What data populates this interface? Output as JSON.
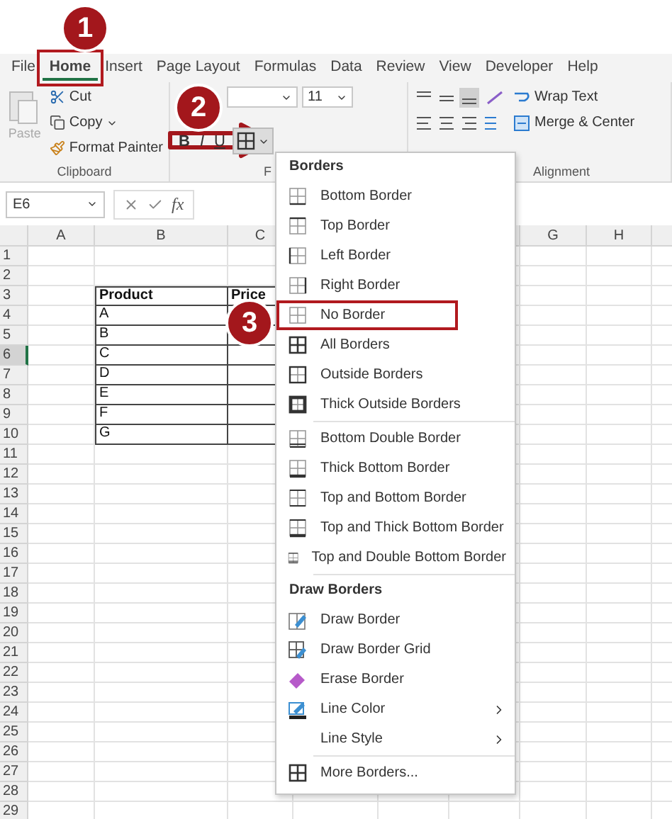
{
  "tabs": [
    {
      "label": "File",
      "selected": false,
      "highlighted": false
    },
    {
      "label": "Home",
      "selected": true,
      "highlighted": true
    },
    {
      "label": "Insert",
      "selected": false,
      "highlighted": false
    },
    {
      "label": "Page Layout",
      "selected": false,
      "highlighted": false
    },
    {
      "label": "Formulas",
      "selected": false,
      "highlighted": false
    },
    {
      "label": "Data",
      "selected": false,
      "highlighted": false
    },
    {
      "label": "Review",
      "selected": false,
      "highlighted": false
    },
    {
      "label": "View",
      "selected": false,
      "highlighted": false
    },
    {
      "label": "Developer",
      "selected": false,
      "highlighted": false
    },
    {
      "label": "Help",
      "selected": false,
      "highlighted": false
    }
  ],
  "clipboard": {
    "paste": "Paste",
    "paste_disabled": true,
    "cut": "Cut",
    "copy": "Copy",
    "format_painter": "Format Painter",
    "label": "Clipboard"
  },
  "font": {
    "size": "11",
    "bold": "B",
    "italic": "I",
    "underline": "U",
    "label": "F"
  },
  "alignment": {
    "wrap_text": "Wrap Text",
    "merge_center": "Merge & Center",
    "label": "Alignment"
  },
  "formula_bar": {
    "name_box": "E6",
    "function": "fx"
  },
  "columns": [
    "A",
    "B",
    "C",
    "G",
    "H"
  ],
  "rows": [
    {
      "number": "1",
      "selected": false
    },
    {
      "number": "2",
      "selected": false
    },
    {
      "number": "3",
      "selected": false
    },
    {
      "number": "4",
      "selected": false
    },
    {
      "number": "5",
      "selected": false
    },
    {
      "number": "6",
      "selected": true
    },
    {
      "number": "7",
      "selected": false
    },
    {
      "number": "8",
      "selected": false
    },
    {
      "number": "9",
      "selected": false
    },
    {
      "number": "10",
      "selected": false
    },
    {
      "number": "11",
      "selected": false
    },
    {
      "number": "12",
      "selected": false
    },
    {
      "number": "13",
      "selected": false
    },
    {
      "number": "14",
      "selected": false
    },
    {
      "number": "15",
      "selected": false
    },
    {
      "number": "16",
      "selected": false
    },
    {
      "number": "17",
      "selected": false
    },
    {
      "number": "18",
      "selected": false
    },
    {
      "number": "19",
      "selected": false
    },
    {
      "number": "20",
      "selected": false
    },
    {
      "number": "21",
      "selected": false
    },
    {
      "number": "22",
      "selected": false
    },
    {
      "number": "23",
      "selected": false
    },
    {
      "number": "24",
      "selected": false
    },
    {
      "number": "25",
      "selected": false
    },
    {
      "number": "26",
      "selected": false
    },
    {
      "number": "27",
      "selected": false
    },
    {
      "number": "28",
      "selected": false
    },
    {
      "number": "29",
      "selected": false
    }
  ],
  "table": {
    "header": [
      "Product",
      "Price"
    ],
    "rows": [
      "A",
      "B",
      "C",
      "D",
      "E",
      "F",
      "G"
    ]
  },
  "menu": [
    {
      "kind": "header",
      "label": "Borders"
    },
    {
      "kind": "item",
      "label": "Bottom Border",
      "highlighted": false
    },
    {
      "kind": "item",
      "label": "Top Border",
      "highlighted": false
    },
    {
      "kind": "item",
      "label": "Left Border",
      "highlighted": false
    },
    {
      "kind": "item",
      "label": "Right Border",
      "highlighted": false
    },
    {
      "kind": "item",
      "label": "No Border",
      "highlighted": true
    },
    {
      "kind": "item",
      "label": "All Borders",
      "highlighted": false
    },
    {
      "kind": "item",
      "label": "Outside Borders",
      "highlighted": false
    },
    {
      "kind": "item",
      "label": "Thick Outside Borders",
      "highlighted": false
    },
    {
      "kind": "separator"
    },
    {
      "kind": "item",
      "label": "Bottom Double Border",
      "highlighted": false
    },
    {
      "kind": "item",
      "label": "Thick Bottom Border",
      "highlighted": false
    },
    {
      "kind": "item",
      "label": "Top and Bottom Border",
      "highlighted": false
    },
    {
      "kind": "item",
      "label": "Top and Thick Bottom Border",
      "highlighted": false
    },
    {
      "kind": "item",
      "label": "Top and Double Bottom Border",
      "highlighted": false
    },
    {
      "kind": "separator"
    },
    {
      "kind": "header",
      "label": "Draw Borders"
    },
    {
      "kind": "item",
      "label": "Draw Border",
      "highlighted": false
    },
    {
      "kind": "item",
      "label": "Draw Border Grid",
      "highlighted": false
    },
    {
      "kind": "item",
      "label": "Erase Border",
      "highlighted": false
    },
    {
      "kind": "submenu",
      "label": "Line Color"
    },
    {
      "kind": "submenu",
      "label": "Line Style"
    },
    {
      "kind": "separator"
    },
    {
      "kind": "item",
      "label": "More Borders...",
      "highlighted": false
    }
  ],
  "callouts": [
    "1",
    "2",
    "3"
  ]
}
